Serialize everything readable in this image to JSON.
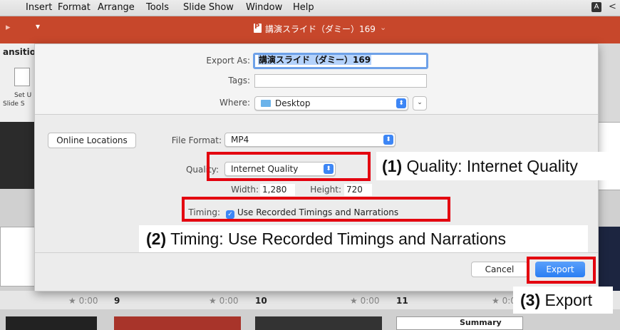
{
  "menubar": {
    "items": [
      "Insert",
      "Format",
      "Arrange",
      "Tools",
      "Slide Show",
      "Window",
      "Help"
    ],
    "input_badge": "A"
  },
  "titlebar": {
    "document_title": "講演スライド（ダミー）169"
  },
  "ribbon": {
    "tab_partial": "ansitio",
    "button_caption_1": "Set U",
    "button_caption_2": "Slide S"
  },
  "export_sheet": {
    "export_as_label": "Export As:",
    "export_as_value": "講演スライド（ダミー）169",
    "tags_label": "Tags:",
    "tags_value": "",
    "where_label": "Where:",
    "where_value": "Desktop",
    "online_locations_label": "Online Locations",
    "file_format_label": "File Format:",
    "file_format_value": "MP4",
    "quality_label": "Quality:",
    "quality_value": "Internet Quality",
    "width_label": "Width:",
    "width_value": "1,280",
    "height_label": "Height:",
    "height_value": "720",
    "timing_label": "Timing:",
    "timing_checkbox_label": "Use Recorded Timings and Narrations",
    "timing_checked": true,
    "cancel_label": "Cancel",
    "export_label": "Export"
  },
  "slide_sorter": {
    "times": [
      "0:00",
      "0:00",
      "0:00",
      "0:0"
    ],
    "slide_numbers": [
      "9",
      "10",
      "11"
    ],
    "summary_label": "Summary"
  },
  "callouts": {
    "quality": {
      "num": "(1)",
      "text": "Quality: Internet Quality"
    },
    "timing": {
      "num": "(2)",
      "text": "Timing: Use Recorded Timings and Narrations"
    },
    "export": {
      "num": "(3)",
      "text": "Export"
    }
  },
  "colors": {
    "accent": "#c7472b",
    "highlight": "#e3000f",
    "primary_button": "#2a7ef3"
  }
}
